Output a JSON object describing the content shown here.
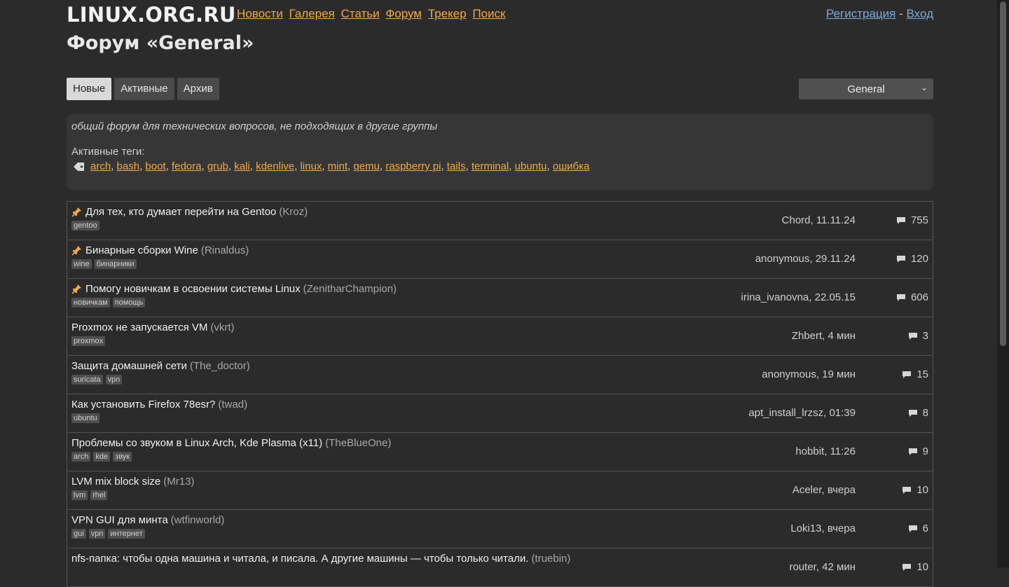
{
  "site": {
    "logo": "LINUX.ORG.RU"
  },
  "nav": [
    "Новости",
    "Галерея",
    "Статьи",
    "Форум",
    "Трекер",
    "Поиск"
  ],
  "auth": {
    "register": "Регистрация",
    "separator": "-",
    "login": "Вход"
  },
  "page_title": "Форум «General»",
  "tabs": [
    {
      "label": "Новые",
      "active": true
    },
    {
      "label": "Активные",
      "active": false
    },
    {
      "label": "Архив",
      "active": false
    }
  ],
  "group_select": {
    "value": "General"
  },
  "info": {
    "description": "общий форум для технических вопросов, не подходящих в другие группы",
    "tags_label": "Активные теги:",
    "tags": [
      "arch",
      "bash",
      "boot",
      "fedora",
      "grub",
      "kali",
      "kdenlive",
      "linux",
      "mint",
      "qemu",
      "raspberry pi",
      "tails",
      "terminal",
      "ubuntu",
      "ошибка"
    ]
  },
  "topics": [
    {
      "pinned": true,
      "title": "Для тех, кто думает перейти на Gentoo",
      "author": "(Kroz)",
      "tags": [
        "gentoo"
      ],
      "last": "Chord, 11.11.24",
      "count": "755"
    },
    {
      "pinned": true,
      "title": "Бинарные сборки Wine",
      "author": "(Rinaldus)",
      "tags": [
        "wine",
        "бинарники"
      ],
      "last": "anonymous, 29.11.24",
      "count": "120"
    },
    {
      "pinned": true,
      "title": "Помогу новичкам в освоении системы Linux",
      "author": "(ZenitharChampion)",
      "tags": [
        "новичкам",
        "помощь"
      ],
      "last": "irina_ivanovna, 22.05.15",
      "count": "606"
    },
    {
      "pinned": false,
      "title": "Proxmox не запускается VM",
      "author": "(vkrt)",
      "tags": [
        "proxmox"
      ],
      "last": "Zhbert, 4 мин",
      "count": "3"
    },
    {
      "pinned": false,
      "title": "Защита домашней сети",
      "author": "(The_doctor)",
      "tags": [
        "suricata",
        "vpn"
      ],
      "last": "anonymous, 19 мин",
      "count": "15"
    },
    {
      "pinned": false,
      "title": "Как установить Firefox 78esr?",
      "author": "(twad)",
      "tags": [
        "ubuntu"
      ],
      "last": "apt_install_lrzsz, 01:39",
      "count": "8"
    },
    {
      "pinned": false,
      "title": "Проблемы со звуком в Linux Arch, Kde Plasma (x11)",
      "author": "(TheBlueOne)",
      "tags": [
        "arch",
        "kde",
        "звук"
      ],
      "last": "hobbit, 11:26",
      "count": "9"
    },
    {
      "pinned": false,
      "title": "LVM mix block size",
      "author": "(Mr13)",
      "tags": [
        "lvm",
        "rhel"
      ],
      "last": "Aceler, вчера",
      "count": "10"
    },
    {
      "pinned": false,
      "title": "VPN GUI для минта",
      "author": "(wtfinworld)",
      "tags": [
        "gui",
        "vpn",
        "интернет"
      ],
      "last": "Loki13, вчера",
      "count": "6"
    },
    {
      "pinned": false,
      "title": "nfs-папка: чтобы одна машина и читала, и писала. А другие машины — чтобы только читали.",
      "author": "(truebin)",
      "tags": [],
      "last": "router, 42 мин",
      "count": "10"
    }
  ]
}
